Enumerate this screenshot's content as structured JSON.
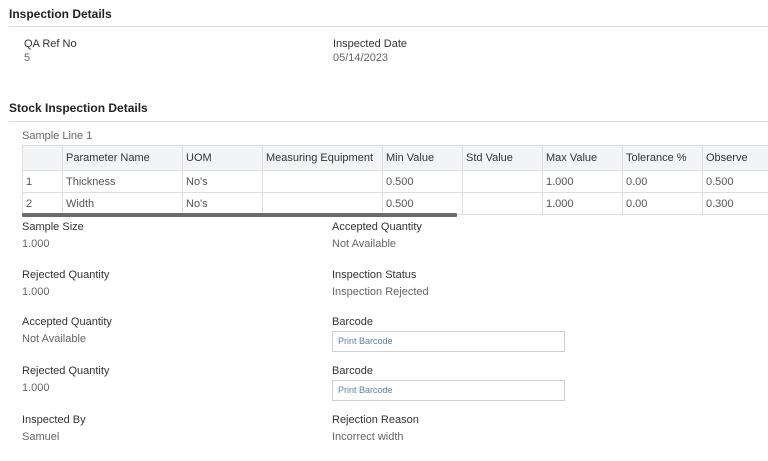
{
  "inspection_details": {
    "title": "Inspection Details",
    "qa_ref": {
      "label": "QA Ref No",
      "value": "5"
    },
    "inspected_date": {
      "label": "Inspected Date",
      "value": "05/14/2023"
    }
  },
  "stock_inspection": {
    "title": "Stock Inspection Details",
    "sample_line_label": "Sample Line 1",
    "columns": [
      "",
      "Parameter Name",
      "UOM",
      "Measuring Equipment",
      "Min Value",
      "Std Value",
      "Max Value",
      "Tolerance %",
      "Observe"
    ],
    "rows": [
      [
        "1",
        "Thickness",
        "No's",
        "",
        "0.500",
        "",
        "1.000",
        "0.00",
        "0.500"
      ],
      [
        "2",
        "Width",
        "No's",
        "",
        "0.500",
        "",
        "1.000",
        "0.00",
        "0.300"
      ]
    ]
  },
  "fields": {
    "sample_size": {
      "label": "Sample Size",
      "value": "1.000"
    },
    "accepted_qty_1": {
      "label": "Accepted Quantity",
      "value": "Not Available"
    },
    "rejected_qty_1": {
      "label": "Rejected Quantity",
      "value": "1.000"
    },
    "inspection_status": {
      "label": "Inspection Status",
      "value": "Inspection Rejected"
    },
    "accepted_qty_2": {
      "label": "Accepted Quantity",
      "value": "Not Available"
    },
    "barcode_1": {
      "label": "Barcode",
      "value": "Print Barcode"
    },
    "rejected_qty_2": {
      "label": "Rejected Quantity",
      "value": "1.000"
    },
    "barcode_2": {
      "label": "Barcode",
      "value": "Print Barcode"
    },
    "inspected_by": {
      "label": "Inspected By",
      "value": "Samuel"
    },
    "rejection_reason": {
      "label": "Rejection Reason",
      "value": "Incorrect width"
    }
  }
}
